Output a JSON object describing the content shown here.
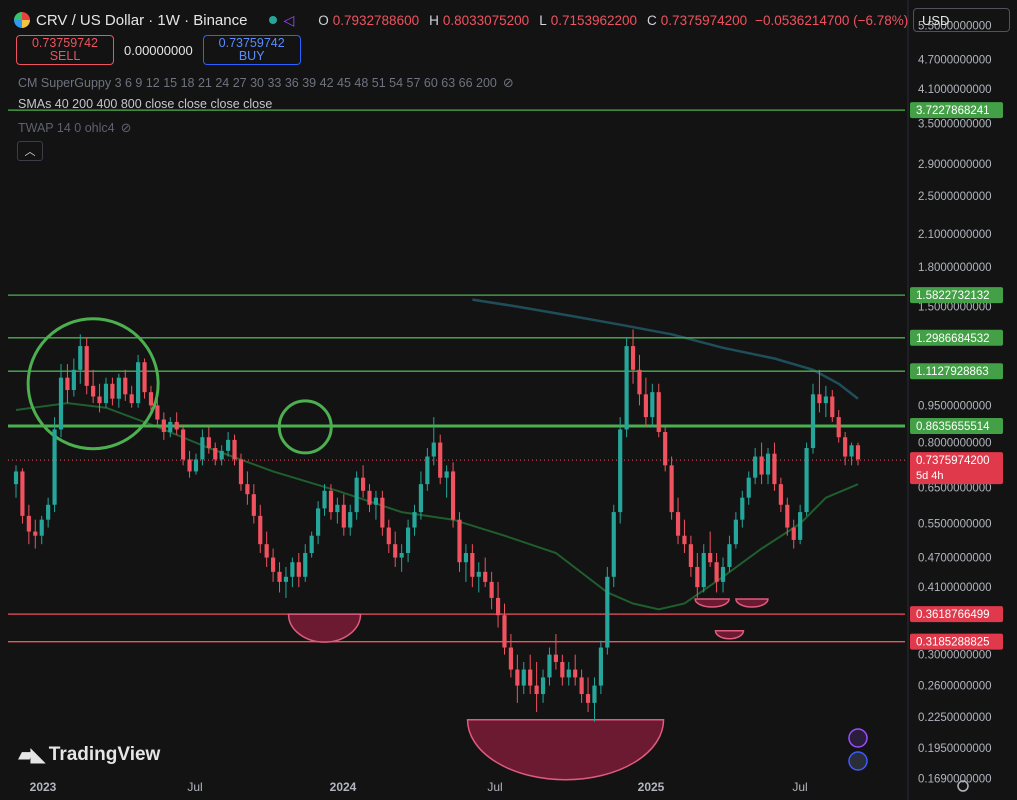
{
  "header": {
    "symbol_title": "CRV / US Dollar · 1W · Binance",
    "ohlc": [
      {
        "k": "O",
        "v": "0.7932788600"
      },
      {
        "k": "H",
        "v": "0.8033075200"
      },
      {
        "k": "L",
        "v": "0.7153962200"
      },
      {
        "k": "C",
        "v": "0.7375974200"
      }
    ],
    "change": "−0.0536214700 (−6.78%)"
  },
  "trade": {
    "sell_price": "0.73759742",
    "sell_label": "SELL",
    "spread": "0.00000000",
    "buy_price": "0.73759742",
    "buy_label": "BUY"
  },
  "indicators": {
    "guppy": "CM SuperGuppy 3 6 9 12 15 18 21 24 27 30 33 36 39 42 45 48 51 54 57 60 63 66 200",
    "smas": "SMAs 40 200 400 800 close close close close",
    "twap": "TWAP 14 0 ohlc4"
  },
  "currency": "USD",
  "brand": "TradingView",
  "colors": {
    "up": "#26a69a",
    "down": "#f0525f",
    "support": "#f0525f",
    "resistance": "#4caf50",
    "sma_green": "#1f5e2e",
    "sma_teal": "#1f4e5a",
    "circle": "#4caf50",
    "bowl": "#8a1e3c"
  },
  "chart_data": {
    "type": "candlestick",
    "scale": "log",
    "ylim": [
      0.168,
      5.7
    ],
    "y_ticks": [
      "5.5000000000",
      "4.7000000000",
      "4.1000000000",
      "3.5000000000",
      "2.9000000000",
      "2.5000000000",
      "2.1000000000",
      "1.8000000000",
      "1.5000000000",
      "0.9500000000",
      "0.8000000000",
      "0.6500000000",
      "0.5500000000",
      "0.4700000000",
      "0.4100000000",
      "0.3000000000",
      "0.2600000000",
      "0.2250000000",
      "0.1950000000",
      "0.1690000000"
    ],
    "x_ticks": [
      "2023",
      "Jul",
      "2024",
      "Jul",
      "2025",
      "Jul"
    ],
    "price_levels": [
      {
        "label": "3.7227868241",
        "value": 3.7227868241,
        "kind": "resistance"
      },
      {
        "label": "1.5822732132",
        "value": 1.5822732132,
        "kind": "resistance"
      },
      {
        "label": "1.2986684532",
        "value": 1.2986684532,
        "kind": "resistance"
      },
      {
        "label": "1.1127928863",
        "value": 1.1127928863,
        "kind": "resistance"
      },
      {
        "label": "0.8635655514",
        "value": 0.8635655514,
        "kind": "resistance"
      },
      {
        "label": "0.3618766499",
        "value": 0.3618766499,
        "kind": "support"
      },
      {
        "label": "0.3185288825",
        "value": 0.3185288825,
        "kind": "support"
      }
    ],
    "last_price": {
      "label": "0.7375974200",
      "countdown": "5d 4h",
      "value": 0.73759742
    },
    "candles": [
      [
        0.66,
        0.72,
        0.62,
        0.7
      ],
      [
        0.7,
        0.71,
        0.55,
        0.57
      ],
      [
        0.57,
        0.6,
        0.5,
        0.53
      ],
      [
        0.53,
        0.56,
        0.49,
        0.52
      ],
      [
        0.52,
        0.57,
        0.5,
        0.56
      ],
      [
        0.56,
        0.62,
        0.54,
        0.6
      ],
      [
        0.6,
        0.9,
        0.58,
        0.85
      ],
      [
        0.85,
        1.15,
        0.82,
        1.08
      ],
      [
        1.08,
        1.15,
        0.96,
        1.02
      ],
      [
        1.02,
        1.18,
        0.99,
        1.12
      ],
      [
        1.12,
        1.32,
        1.05,
        1.25
      ],
      [
        1.25,
        1.3,
        1.0,
        1.04
      ],
      [
        1.04,
        1.12,
        0.96,
        0.99
      ],
      [
        0.99,
        1.05,
        0.92,
        0.96
      ],
      [
        0.96,
        1.08,
        0.94,
        1.05
      ],
      [
        1.05,
        1.08,
        0.95,
        0.98
      ],
      [
        0.98,
        1.1,
        0.94,
        1.08
      ],
      [
        1.08,
        1.12,
        0.97,
        1.0
      ],
      [
        1.0,
        1.04,
        0.94,
        0.96
      ],
      [
        0.96,
        1.2,
        0.94,
        1.16
      ],
      [
        1.16,
        1.18,
        0.98,
        1.01
      ],
      [
        1.01,
        1.04,
        0.93,
        0.95
      ],
      [
        0.95,
        0.99,
        0.86,
        0.89
      ],
      [
        0.89,
        0.92,
        0.81,
        0.84
      ],
      [
        0.84,
        0.9,
        0.82,
        0.88
      ],
      [
        0.88,
        0.92,
        0.83,
        0.85
      ],
      [
        0.85,
        0.87,
        0.72,
        0.74
      ],
      [
        0.74,
        0.77,
        0.68,
        0.7
      ],
      [
        0.7,
        0.76,
        0.69,
        0.74
      ],
      [
        0.74,
        0.85,
        0.72,
        0.82
      ],
      [
        0.82,
        0.86,
        0.76,
        0.78
      ],
      [
        0.78,
        0.8,
        0.72,
        0.74
      ],
      [
        0.74,
        0.79,
        0.72,
        0.77
      ],
      [
        0.77,
        0.84,
        0.75,
        0.81
      ],
      [
        0.81,
        0.83,
        0.72,
        0.74
      ],
      [
        0.74,
        0.76,
        0.64,
        0.66
      ],
      [
        0.66,
        0.7,
        0.6,
        0.63
      ],
      [
        0.63,
        0.66,
        0.55,
        0.57
      ],
      [
        0.57,
        0.6,
        0.48,
        0.5
      ],
      [
        0.5,
        0.53,
        0.45,
        0.47
      ],
      [
        0.47,
        0.49,
        0.42,
        0.44
      ],
      [
        0.44,
        0.46,
        0.4,
        0.42
      ],
      [
        0.42,
        0.45,
        0.39,
        0.43
      ],
      [
        0.43,
        0.47,
        0.41,
        0.46
      ],
      [
        0.46,
        0.48,
        0.41,
        0.43
      ],
      [
        0.43,
        0.5,
        0.42,
        0.48
      ],
      [
        0.48,
        0.53,
        0.47,
        0.52
      ],
      [
        0.52,
        0.61,
        0.5,
        0.59
      ],
      [
        0.59,
        0.66,
        0.57,
        0.64
      ],
      [
        0.64,
        0.66,
        0.56,
        0.58
      ],
      [
        0.58,
        0.62,
        0.55,
        0.6
      ],
      [
        0.6,
        0.63,
        0.52,
        0.54
      ],
      [
        0.54,
        0.6,
        0.52,
        0.58
      ],
      [
        0.58,
        0.7,
        0.56,
        0.68
      ],
      [
        0.68,
        0.72,
        0.62,
        0.64
      ],
      [
        0.64,
        0.66,
        0.58,
        0.6
      ],
      [
        0.6,
        0.64,
        0.56,
        0.62
      ],
      [
        0.62,
        0.64,
        0.52,
        0.54
      ],
      [
        0.54,
        0.56,
        0.48,
        0.5
      ],
      [
        0.5,
        0.53,
        0.45,
        0.47
      ],
      [
        0.47,
        0.5,
        0.44,
        0.48
      ],
      [
        0.48,
        0.56,
        0.46,
        0.54
      ],
      [
        0.54,
        0.6,
        0.52,
        0.58
      ],
      [
        0.58,
        0.7,
        0.56,
        0.66
      ],
      [
        0.66,
        0.78,
        0.64,
        0.75
      ],
      [
        0.75,
        0.9,
        0.72,
        0.8
      ],
      [
        0.8,
        0.83,
        0.66,
        0.68
      ],
      [
        0.68,
        0.72,
        0.62,
        0.7
      ],
      [
        0.7,
        0.73,
        0.54,
        0.56
      ],
      [
        0.56,
        0.58,
        0.44,
        0.46
      ],
      [
        0.46,
        0.5,
        0.42,
        0.48
      ],
      [
        0.48,
        0.5,
        0.41,
        0.43
      ],
      [
        0.43,
        0.46,
        0.4,
        0.44
      ],
      [
        0.44,
        0.47,
        0.41,
        0.42
      ],
      [
        0.42,
        0.44,
        0.37,
        0.39
      ],
      [
        0.39,
        0.42,
        0.34,
        0.36
      ],
      [
        0.36,
        0.38,
        0.3,
        0.31
      ],
      [
        0.31,
        0.33,
        0.27,
        0.28
      ],
      [
        0.28,
        0.3,
        0.24,
        0.26
      ],
      [
        0.26,
        0.29,
        0.25,
        0.28
      ],
      [
        0.28,
        0.3,
        0.25,
        0.26
      ],
      [
        0.26,
        0.29,
        0.23,
        0.25
      ],
      [
        0.25,
        0.28,
        0.24,
        0.27
      ],
      [
        0.27,
        0.31,
        0.26,
        0.3
      ],
      [
        0.3,
        0.33,
        0.28,
        0.29
      ],
      [
        0.29,
        0.3,
        0.26,
        0.27
      ],
      [
        0.27,
        0.29,
        0.26,
        0.28
      ],
      [
        0.28,
        0.3,
        0.26,
        0.27
      ],
      [
        0.27,
        0.28,
        0.24,
        0.25
      ],
      [
        0.25,
        0.27,
        0.23,
        0.24
      ],
      [
        0.24,
        0.27,
        0.22,
        0.26
      ],
      [
        0.26,
        0.32,
        0.25,
        0.31
      ],
      [
        0.31,
        0.45,
        0.3,
        0.43
      ],
      [
        0.43,
        0.6,
        0.41,
        0.58
      ],
      [
        0.58,
        0.9,
        0.55,
        0.85
      ],
      [
        0.85,
        1.3,
        0.82,
        1.25
      ],
      [
        1.25,
        1.35,
        1.05,
        1.12
      ],
      [
        1.12,
        1.2,
        0.95,
        1.0
      ],
      [
        1.0,
        1.08,
        0.86,
        0.9
      ],
      [
        0.9,
        1.05,
        0.86,
        1.01
      ],
      [
        1.01,
        1.05,
        0.82,
        0.84
      ],
      [
        0.84,
        0.86,
        0.7,
        0.72
      ],
      [
        0.72,
        0.75,
        0.56,
        0.58
      ],
      [
        0.58,
        0.62,
        0.5,
        0.52
      ],
      [
        0.52,
        0.56,
        0.48,
        0.5
      ],
      [
        0.5,
        0.52,
        0.43,
        0.45
      ],
      [
        0.45,
        0.48,
        0.39,
        0.41
      ],
      [
        0.41,
        0.5,
        0.4,
        0.48
      ],
      [
        0.48,
        0.53,
        0.45,
        0.46
      ],
      [
        0.46,
        0.48,
        0.4,
        0.42
      ],
      [
        0.42,
        0.47,
        0.4,
        0.45
      ],
      [
        0.45,
        0.52,
        0.44,
        0.5
      ],
      [
        0.5,
        0.58,
        0.49,
        0.56
      ],
      [
        0.56,
        0.64,
        0.54,
        0.62
      ],
      [
        0.62,
        0.7,
        0.6,
        0.68
      ],
      [
        0.68,
        0.78,
        0.66,
        0.75
      ],
      [
        0.75,
        0.8,
        0.66,
        0.69
      ],
      [
        0.69,
        0.78,
        0.66,
        0.76
      ],
      [
        0.76,
        0.8,
        0.64,
        0.66
      ],
      [
        0.66,
        0.68,
        0.58,
        0.6
      ],
      [
        0.6,
        0.62,
        0.52,
        0.54
      ],
      [
        0.54,
        0.56,
        0.49,
        0.51
      ],
      [
        0.51,
        0.6,
        0.5,
        0.58
      ],
      [
        0.58,
        0.8,
        0.57,
        0.78
      ],
      [
        0.78,
        1.05,
        0.76,
        1.0
      ],
      [
        1.0,
        1.12,
        0.92,
        0.96
      ],
      [
        0.96,
        1.04,
        0.9,
        0.99
      ],
      [
        0.99,
        1.02,
        0.88,
        0.9
      ],
      [
        0.9,
        0.93,
        0.8,
        0.82
      ],
      [
        0.82,
        0.84,
        0.72,
        0.75
      ],
      [
        0.75,
        0.8,
        0.72,
        0.79
      ],
      [
        0.79,
        0.8,
        0.72,
        0.74
      ]
    ],
    "sma_green": [
      [
        0,
        0.93
      ],
      [
        8,
        0.96
      ],
      [
        14,
        0.94
      ],
      [
        22,
        0.86
      ],
      [
        30,
        0.78
      ],
      [
        40,
        0.7
      ],
      [
        50,
        0.64
      ],
      [
        60,
        0.58
      ],
      [
        68,
        0.56
      ],
      [
        76,
        0.52
      ],
      [
        84,
        0.48
      ],
      [
        92,
        0.4
      ],
      [
        96,
        0.38
      ],
      [
        100,
        0.37
      ],
      [
        104,
        0.38
      ],
      [
        110,
        0.43
      ],
      [
        116,
        0.49
      ],
      [
        122,
        0.55
      ],
      [
        126,
        0.62
      ],
      [
        131,
        0.66
      ]
    ],
    "sma_teal": [
      [
        71,
        1.55
      ],
      [
        78,
        1.5
      ],
      [
        86,
        1.44
      ],
      [
        94,
        1.38
      ],
      [
        102,
        1.32
      ],
      [
        110,
        1.24
      ],
      [
        118,
        1.18
      ],
      [
        124,
        1.12
      ],
      [
        128,
        1.05
      ],
      [
        131,
        0.98
      ]
    ]
  }
}
